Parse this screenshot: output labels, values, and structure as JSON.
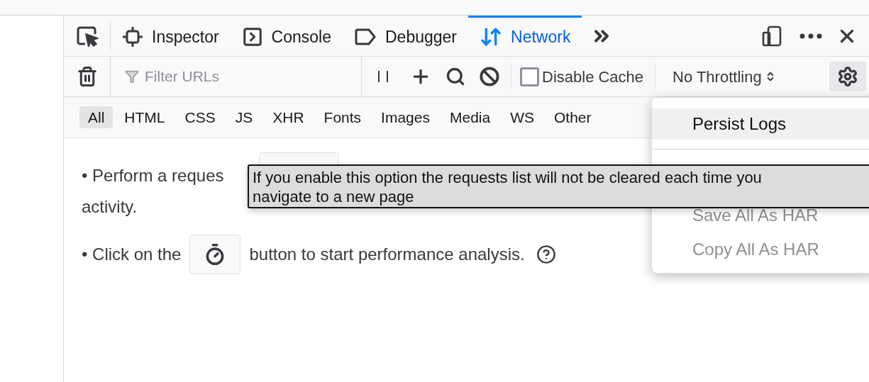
{
  "tabs": [
    {
      "label": "Inspector",
      "kind": "inspector",
      "selected": false
    },
    {
      "label": "Console",
      "kind": "console",
      "selected": false
    },
    {
      "label": "Debugger",
      "kind": "debugger",
      "selected": false
    },
    {
      "label": "Network",
      "kind": "network",
      "selected": true
    }
  ],
  "toolbar": {
    "filter_placeholder": "Filter URLs",
    "disable_cache": {
      "label": "Disable Cache",
      "checked": false
    },
    "throttling": "No Throttling",
    "settings_open": true
  },
  "filter_types": [
    {
      "label": "All",
      "selected": true
    },
    {
      "label": "HTML",
      "selected": false
    },
    {
      "label": "CSS",
      "selected": false
    },
    {
      "label": "JS",
      "selected": false
    },
    {
      "label": "XHR",
      "selected": false
    },
    {
      "label": "Fonts",
      "selected": false
    },
    {
      "label": "Images",
      "selected": false
    },
    {
      "label": "Media",
      "selected": false
    },
    {
      "label": "WS",
      "selected": false
    },
    {
      "label": "Other",
      "selected": false
    }
  ],
  "notice": {
    "line_1": "• Perform a reques",
    "line_2": "activity.",
    "line_3_before": "• Click on the",
    "line_3_after": "button to start performance analysis."
  },
  "settings_menu": [
    {
      "label": "Persist Logs",
      "highlighted": true,
      "disabled": false
    },
    {
      "label": "Save All As HAR",
      "highlighted": false,
      "disabled": true
    },
    {
      "label": "Copy All As HAR",
      "highlighted": false,
      "disabled": true
    }
  ],
  "tooltip": "If you enable this option the requests list will not be cleared each time you navigate to a new page"
}
